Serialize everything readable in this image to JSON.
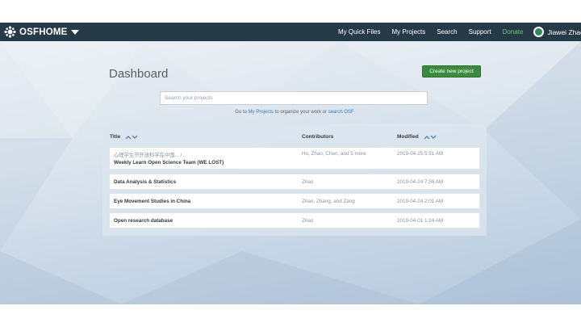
{
  "navbar": {
    "brand_osf": "OSF",
    "brand_home": "HOME",
    "links": [
      {
        "label": "My Quick Files"
      },
      {
        "label": "My Projects"
      },
      {
        "label": "Search"
      },
      {
        "label": "Support"
      },
      {
        "label": "Donate"
      }
    ],
    "user_name": "Jiawei Zhao"
  },
  "dashboard": {
    "title": "Dashboard",
    "create_label": "Create new project",
    "search_placeholder": "Search your projects",
    "goto_prefix": "Go to ",
    "goto_myprojects": "My Projects",
    "goto_middle": " to organize your work or ",
    "goto_search": "search OSF"
  },
  "table": {
    "headers": {
      "title": "Title",
      "contributors": "Contributors",
      "modified": "Modified"
    },
    "rows": [
      {
        "title_line1": "心理学生节开放科学在中国... /",
        "title_line2": "Weekly Learn Open Science Team (WE LOST)",
        "contributors": "Hu, Zhao, Chen, and 5 more",
        "modified": "2019-04-25 5:51 AM"
      },
      {
        "title_line1": "Data Analysis & Statistics",
        "contributors": "Zhao",
        "modified": "2019-04-24 7:58 AM"
      },
      {
        "title_line1": "Eye Movement Studies in China",
        "contributors": "Zhao, Zhang, and Zang",
        "modified": "2019-04-24 2:01 AM"
      },
      {
        "title_line1": "Open research database",
        "contributors": "Zhao",
        "modified": "2019-04-01 1:24 AM"
      }
    ]
  },
  "colors": {
    "navbar_bg": "#263947",
    "donate": "#6cc77a",
    "create_button": "#3c8a3e",
    "link": "#337ab7"
  }
}
